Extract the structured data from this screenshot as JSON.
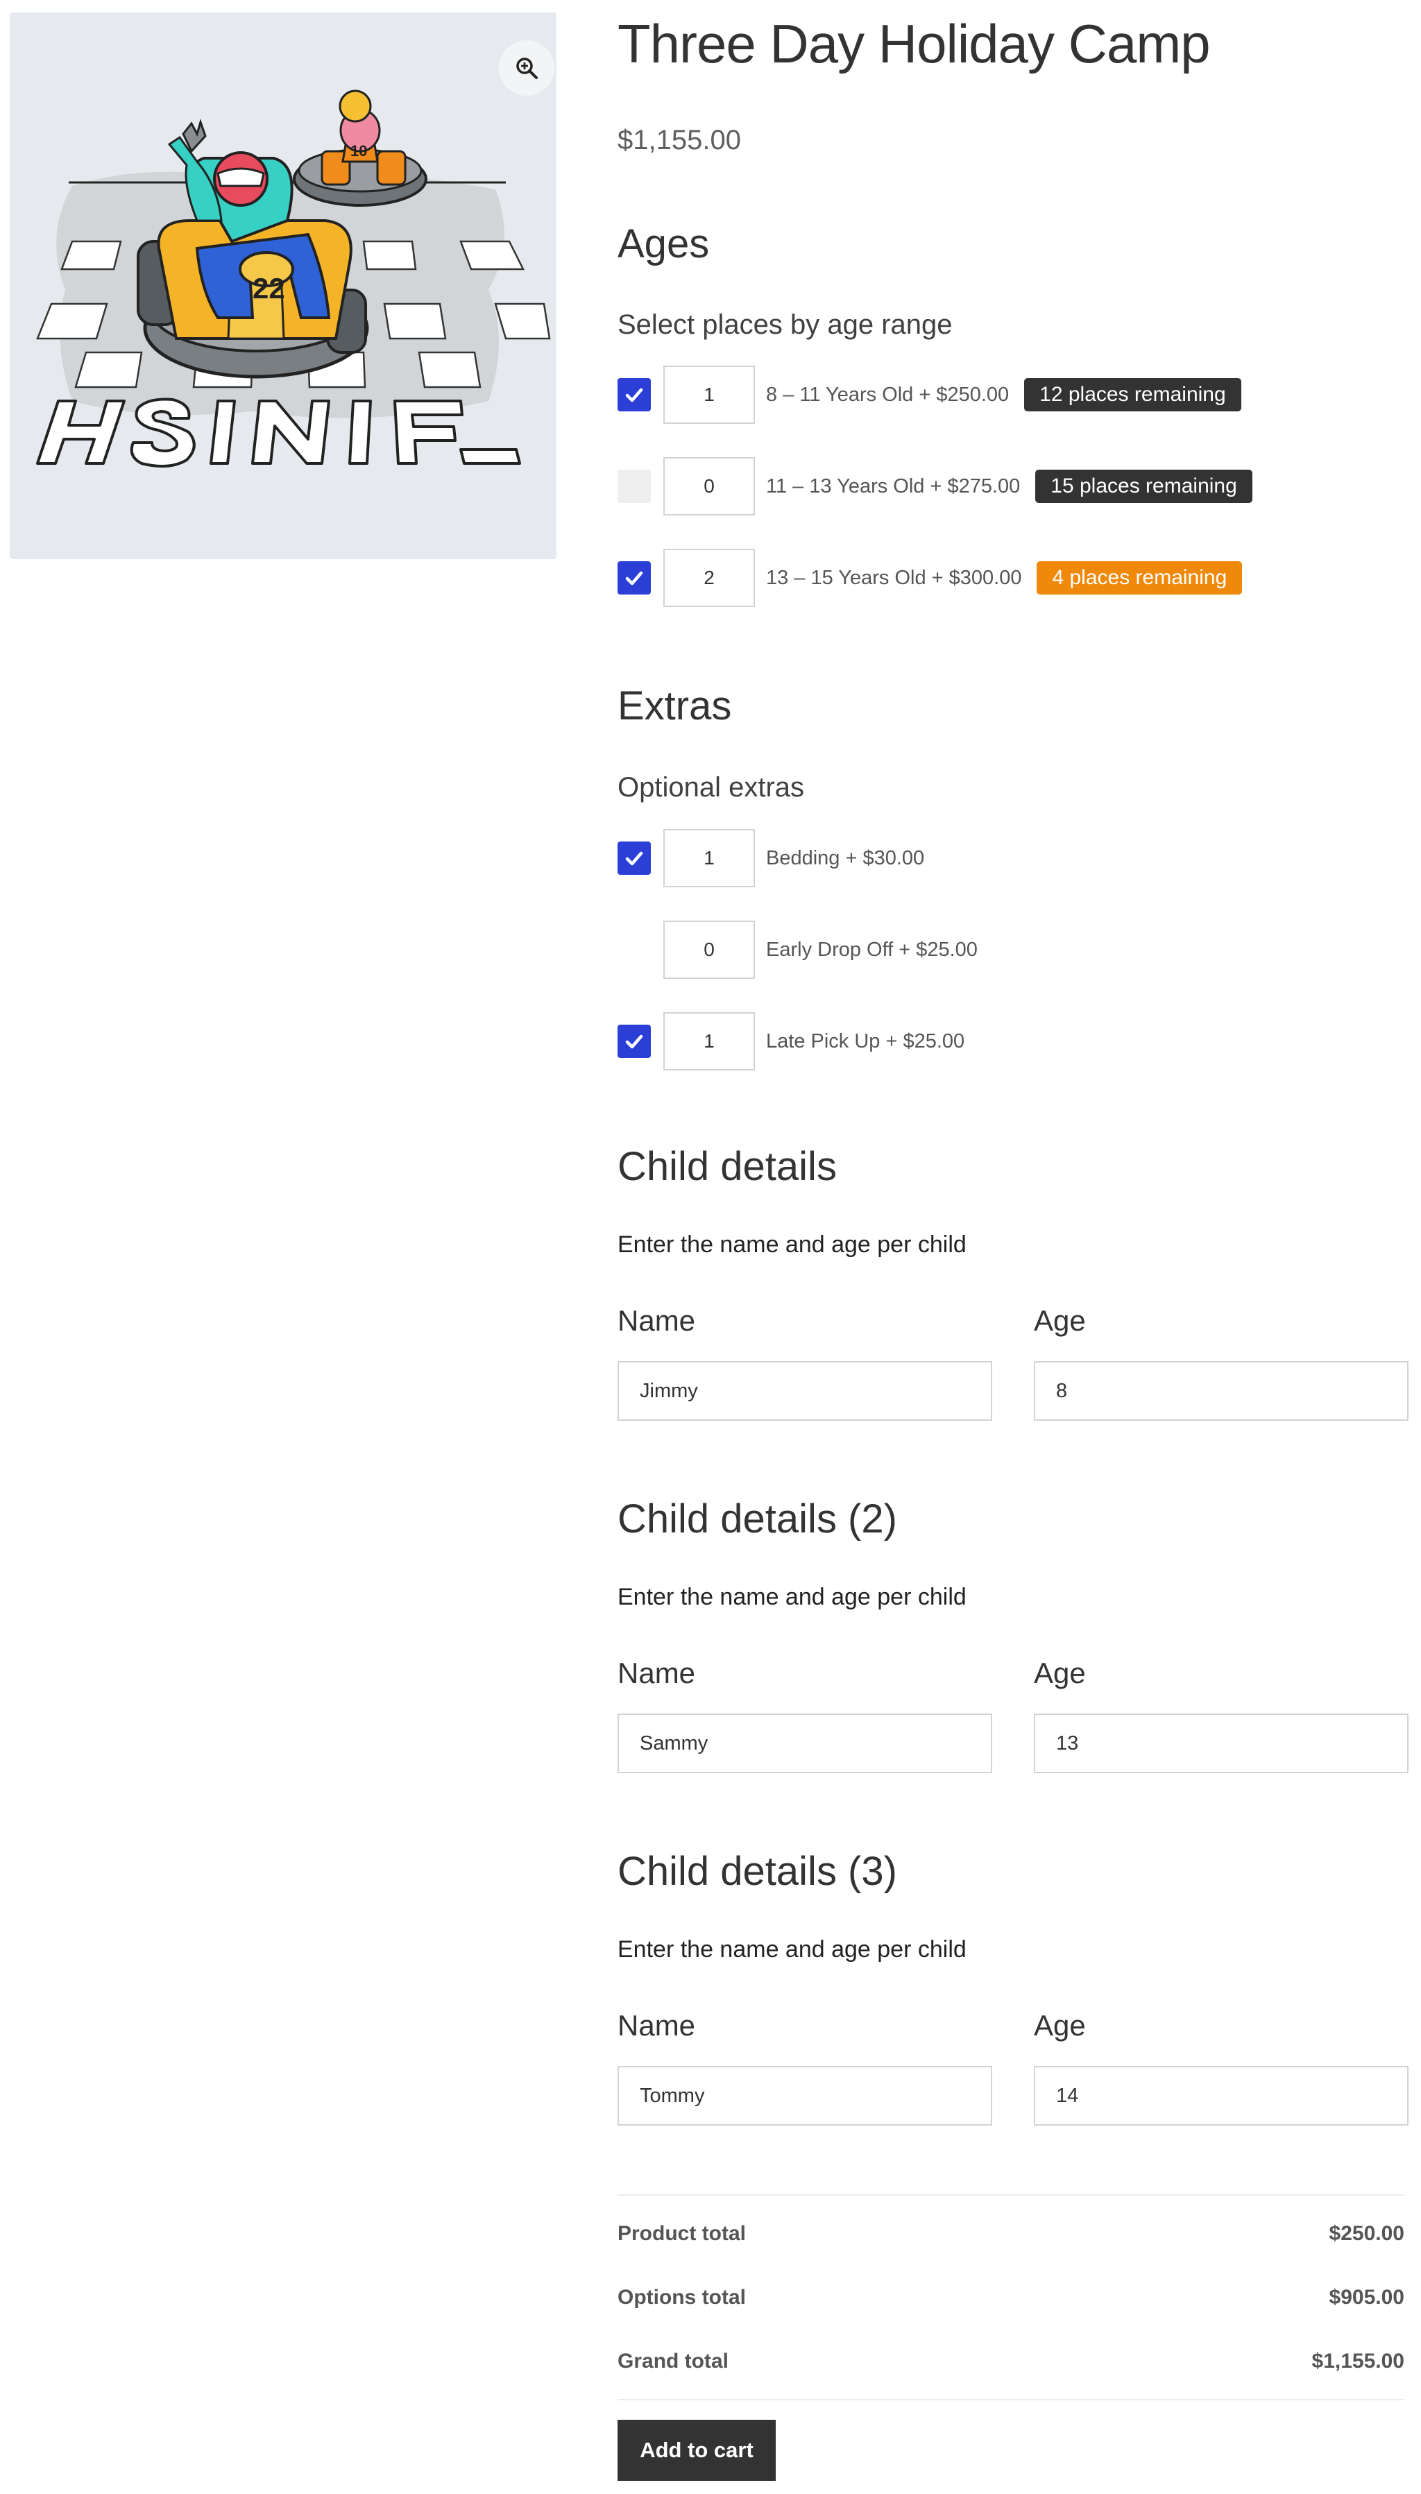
{
  "product": {
    "title": "Three Day Holiday Camp",
    "price": "$1,155.00",
    "image_icon": "zoom-in-icon"
  },
  "ages": {
    "heading": "Ages",
    "subheading": "Select places by age range",
    "options": [
      {
        "checked": true,
        "qty": "1",
        "label": "8 – 11 Years Old + $250.00",
        "badge": "12 places remaining",
        "badge_color": "#333333"
      },
      {
        "checked": false,
        "qty": "0",
        "label": "11 – 13 Years Old + $275.00",
        "badge": "15 places remaining",
        "badge_color": "#333333"
      },
      {
        "checked": true,
        "qty": "2",
        "label": "13 – 15 Years Old + $300.00",
        "badge": "4 places remaining",
        "badge_color": "#f0880a"
      }
    ]
  },
  "extras": {
    "heading": "Extras",
    "subheading": "Optional extras",
    "options": [
      {
        "checked": true,
        "qty": "1",
        "label": "Bedding + $30.00"
      },
      {
        "checked": false,
        "qty": "0",
        "label": "Early Drop Off + $25.00"
      },
      {
        "checked": true,
        "qty": "1",
        "label": "Late Pick Up + $25.00"
      }
    ]
  },
  "children": [
    {
      "heading": "Child details",
      "description": "Enter the name and age per child",
      "name_label": "Name",
      "age_label": "Age",
      "name": "Jimmy",
      "age": "8"
    },
    {
      "heading": "Child details (2)",
      "description": "Enter the name and age per child",
      "name_label": "Name",
      "age_label": "Age",
      "name": "Sammy",
      "age": "13"
    },
    {
      "heading": "Child details (3)",
      "description": "Enter the name and age per child",
      "name_label": "Name",
      "age_label": "Age",
      "name": "Tommy",
      "age": "14"
    }
  ],
  "totals": {
    "product_label": "Product total",
    "product_value": "$250.00",
    "options_label": "Options total",
    "options_value": "$905.00",
    "grand_label": "Grand total",
    "grand_value": "$1,155.00"
  },
  "cart": {
    "button_label": "Add to cart"
  },
  "colors": {
    "checkbox": "#2b3fd6",
    "button": "#333333",
    "badge_dark": "#333333",
    "badge_orange": "#f0880a"
  }
}
